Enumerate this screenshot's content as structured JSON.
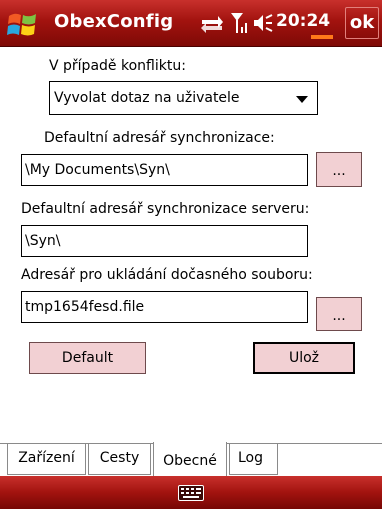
{
  "titlebar": {
    "app_title": "ObexConfig",
    "clock": "20:24",
    "ok_label": "ok",
    "icons": [
      "windows-start-icon",
      "connectivity-icon",
      "signal-icon",
      "volume-icon"
    ]
  },
  "form": {
    "conflict_label": "V případě konfliktu:",
    "conflict_value": "Vyvolat dotaz na uživatele",
    "sync_dir_label": "Defaultní adresář synchronizace:",
    "sync_dir_value": "\\My Documents\\Syn\\",
    "browse_label": "...",
    "server_dir_label": "Defaultní adresář synchronizace serveru:",
    "server_dir_value": "\\Syn\\",
    "temp_file_label": "Adresář pro ukládání dočasného souboru:",
    "temp_file_value": "tmp1654fesd.file",
    "default_button": "Default",
    "save_button": "Ulož"
  },
  "tabs": [
    {
      "label": "Zařízení",
      "active": false
    },
    {
      "label": "Cesty",
      "active": false
    },
    {
      "label": "Obecné",
      "active": true
    },
    {
      "label": "Log",
      "active": false
    }
  ],
  "menubar": {
    "icon": "keyboard-icon"
  },
  "colors": {
    "titlebar": "#a2130f",
    "button_fill": "#f2d0d3",
    "clock_accent": "#ff7a1a"
  }
}
